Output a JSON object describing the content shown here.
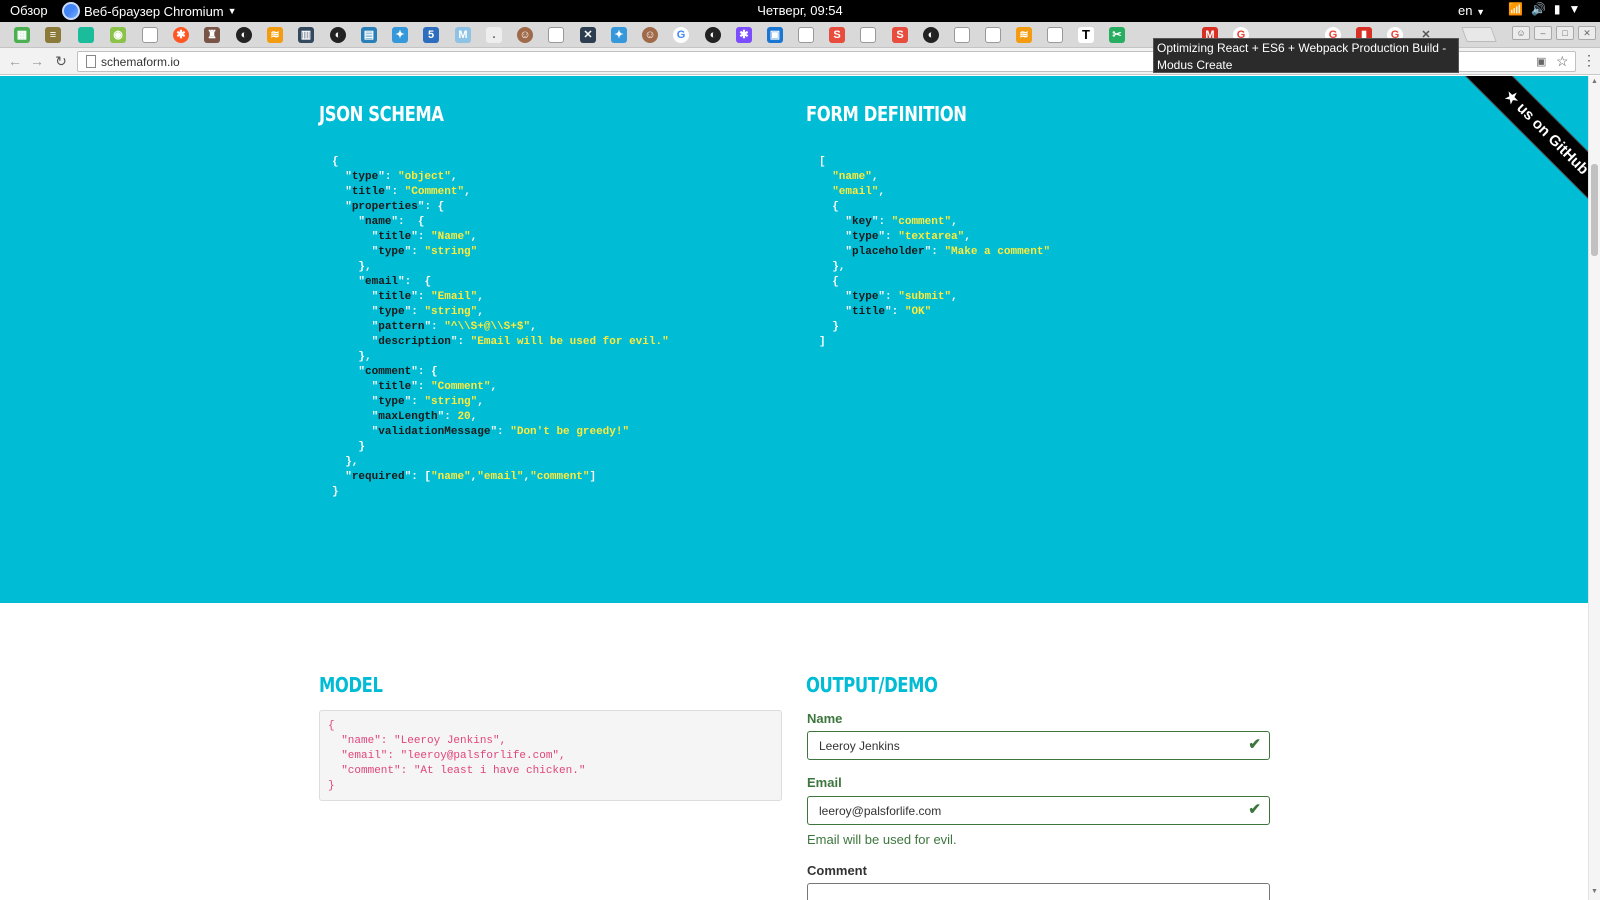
{
  "topbar": {
    "activities": "Обзор",
    "app_name": "Веб-браузер Chromium",
    "clock": "Четверг, 09:54",
    "lang": "en"
  },
  "tooltip": {
    "text": "Optimizing React + ES6 + Webpack Production Build - Modus Create"
  },
  "addressbar": {
    "url": "schemaform.io"
  },
  "ribbon": {
    "text": "★ us on GitHub"
  },
  "json_schema": {
    "title": "JSON SCHEMA"
  },
  "form_definition": {
    "title": "FORM DEFINITION"
  },
  "model": {
    "title": "MODEL",
    "lines": [
      "{",
      "  \"name\": \"Leeroy Jenkins\",",
      "  \"email\": \"leeroy@palsforlife.com\",",
      "  \"comment\": \"At least i have chicken.\"",
      "}"
    ]
  },
  "output": {
    "title": "OUTPUT/DEMO",
    "name_label": "Name",
    "name_value": "Leeroy Jenkins",
    "email_label": "Email",
    "email_value": "leeroy@palsforlife.com",
    "email_help": "Email will be used for evil.",
    "comment_label": "Comment"
  },
  "colors": {
    "teal": "#00bcd4",
    "string_yellow": "#ffeb3b",
    "success_green": "#3c763d",
    "model_pink": "#e0457b"
  }
}
